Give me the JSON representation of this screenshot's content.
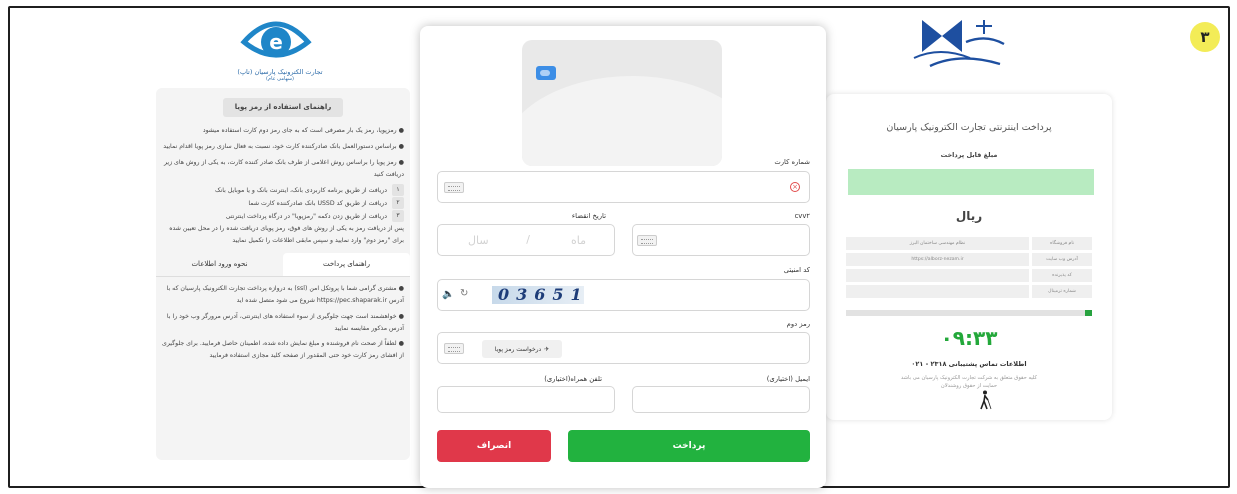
{
  "step_number": "۳",
  "colors": {
    "accent_green": "#22b23f",
    "danger_red": "#e0384a",
    "timer_green": "#23a83a",
    "badge_yellow": "#f3ec57"
  },
  "pars": {
    "name": "تجارت الکترونیک پارسیان (تاپ)",
    "sub": "(سهامی عام)"
  },
  "guide": {
    "title": "راهنمای استفاده از رمز پویا",
    "paragraphs": [
      "● رمزپویا، رمز یک بار مصرفی است که به جای رمز دوم کارت استفاده میشود",
      "● براساس دستورالعمل بانک صادرکننده کارت خود، نسبت به فعال سازی رمز پویا اقدام نمایید",
      "● رمز پویا را براساس روش اعلامی از طرف بانک صادر کننده کارت، به یکی از روش های زیر دریافت کنید"
    ],
    "methods": [
      {
        "num": "۱",
        "text": "دریافت از طریق برنامه کاربردی بانک، اینترنت بانک و یا موبایل بانک"
      },
      {
        "num": "۲",
        "text": "دریافت از طریق کد USSD بانک صادرکننده کارت شما"
      },
      {
        "num": "۳",
        "text": "دریافت از طریق زدن دکمه \"رمزپویا\" در درگاه پرداخت اینترنتی"
      }
    ],
    "after": "پس از دریافت رمز به یکی از روش های فوق، رمز پویای دریافت شده را در محل تعیین شده برای \"رمز دوم\" وارد نمایید و سپس مابقی اطلاعات را تکمیل نمایید"
  },
  "tabs": [
    {
      "label": "راهنمای پرداخت"
    },
    {
      "label": "نحوه ورود اطلاعات"
    }
  ],
  "tips": [
    "● مشتری گرامی شما با پروتکل امن (ssl) به دروازه پرداخت تجارت الکترونیک پارسیان که با آدرس https://pec.shaparak.ir شروع می شود متصل شده اید",
    "● خواهشمند است جهت جلوگیری از سوء استفاده های اینترنتی، آدرس مرورگر وب خود را با آدرس مذکور مقایسه نمایید",
    "● لطفاً از صحت نام فروشنده و مبلغ نمایش داده شده، اطمینان حاصل فرمایید. برای جلوگیری از افشای رمز کارت خود حتی المقدور از صفحه کلید مجازی استفاده فرمایید"
  ],
  "form": {
    "card_number_label": "شماره کارت",
    "cvv_label": "cvv۲",
    "expiry_label": "تاریخ انقضاء",
    "expiry_month": "ماه",
    "expiry_year": "سال",
    "captcha_label": "کد امنیتی",
    "captcha_code": "03651",
    "password_label": "رمز دوم",
    "otp_button": "درخواست رمز پویا",
    "email_label": "ایمیل (اختیاری)",
    "phone_label": "تلفن همراه(اختیاری)",
    "pay_button": "پرداخت",
    "cancel_button": "انصراف"
  },
  "summary": {
    "title": "پرداخت اینترنتی تجارت الکترونیک پارسیان",
    "amount_label": "مبلغ قابل پرداخت",
    "currency": "ریال",
    "rows": [
      {
        "key": "نام فروشگاه",
        "value": "نظام مهندسی ساختمان البرز"
      },
      {
        "key": "آدرس وب سایت",
        "value": "https://alborz-nezam.ir"
      },
      {
        "key": "کد پذیرنده",
        "value": ""
      },
      {
        "key": "شماره ترمینال",
        "value": ""
      }
    ],
    "timer_progress": 0.03,
    "timer": "۰۹:۳۳",
    "support": "اطلاعات تماس پشتیبانی ۲۳۱۸ - ۰۲۱",
    "copyright": "کلیه حقوق متعلق به شرکت تجارت الکترونیک پارسیان می باشد",
    "accessibility": "حمایت از حقوق روشندلان"
  }
}
